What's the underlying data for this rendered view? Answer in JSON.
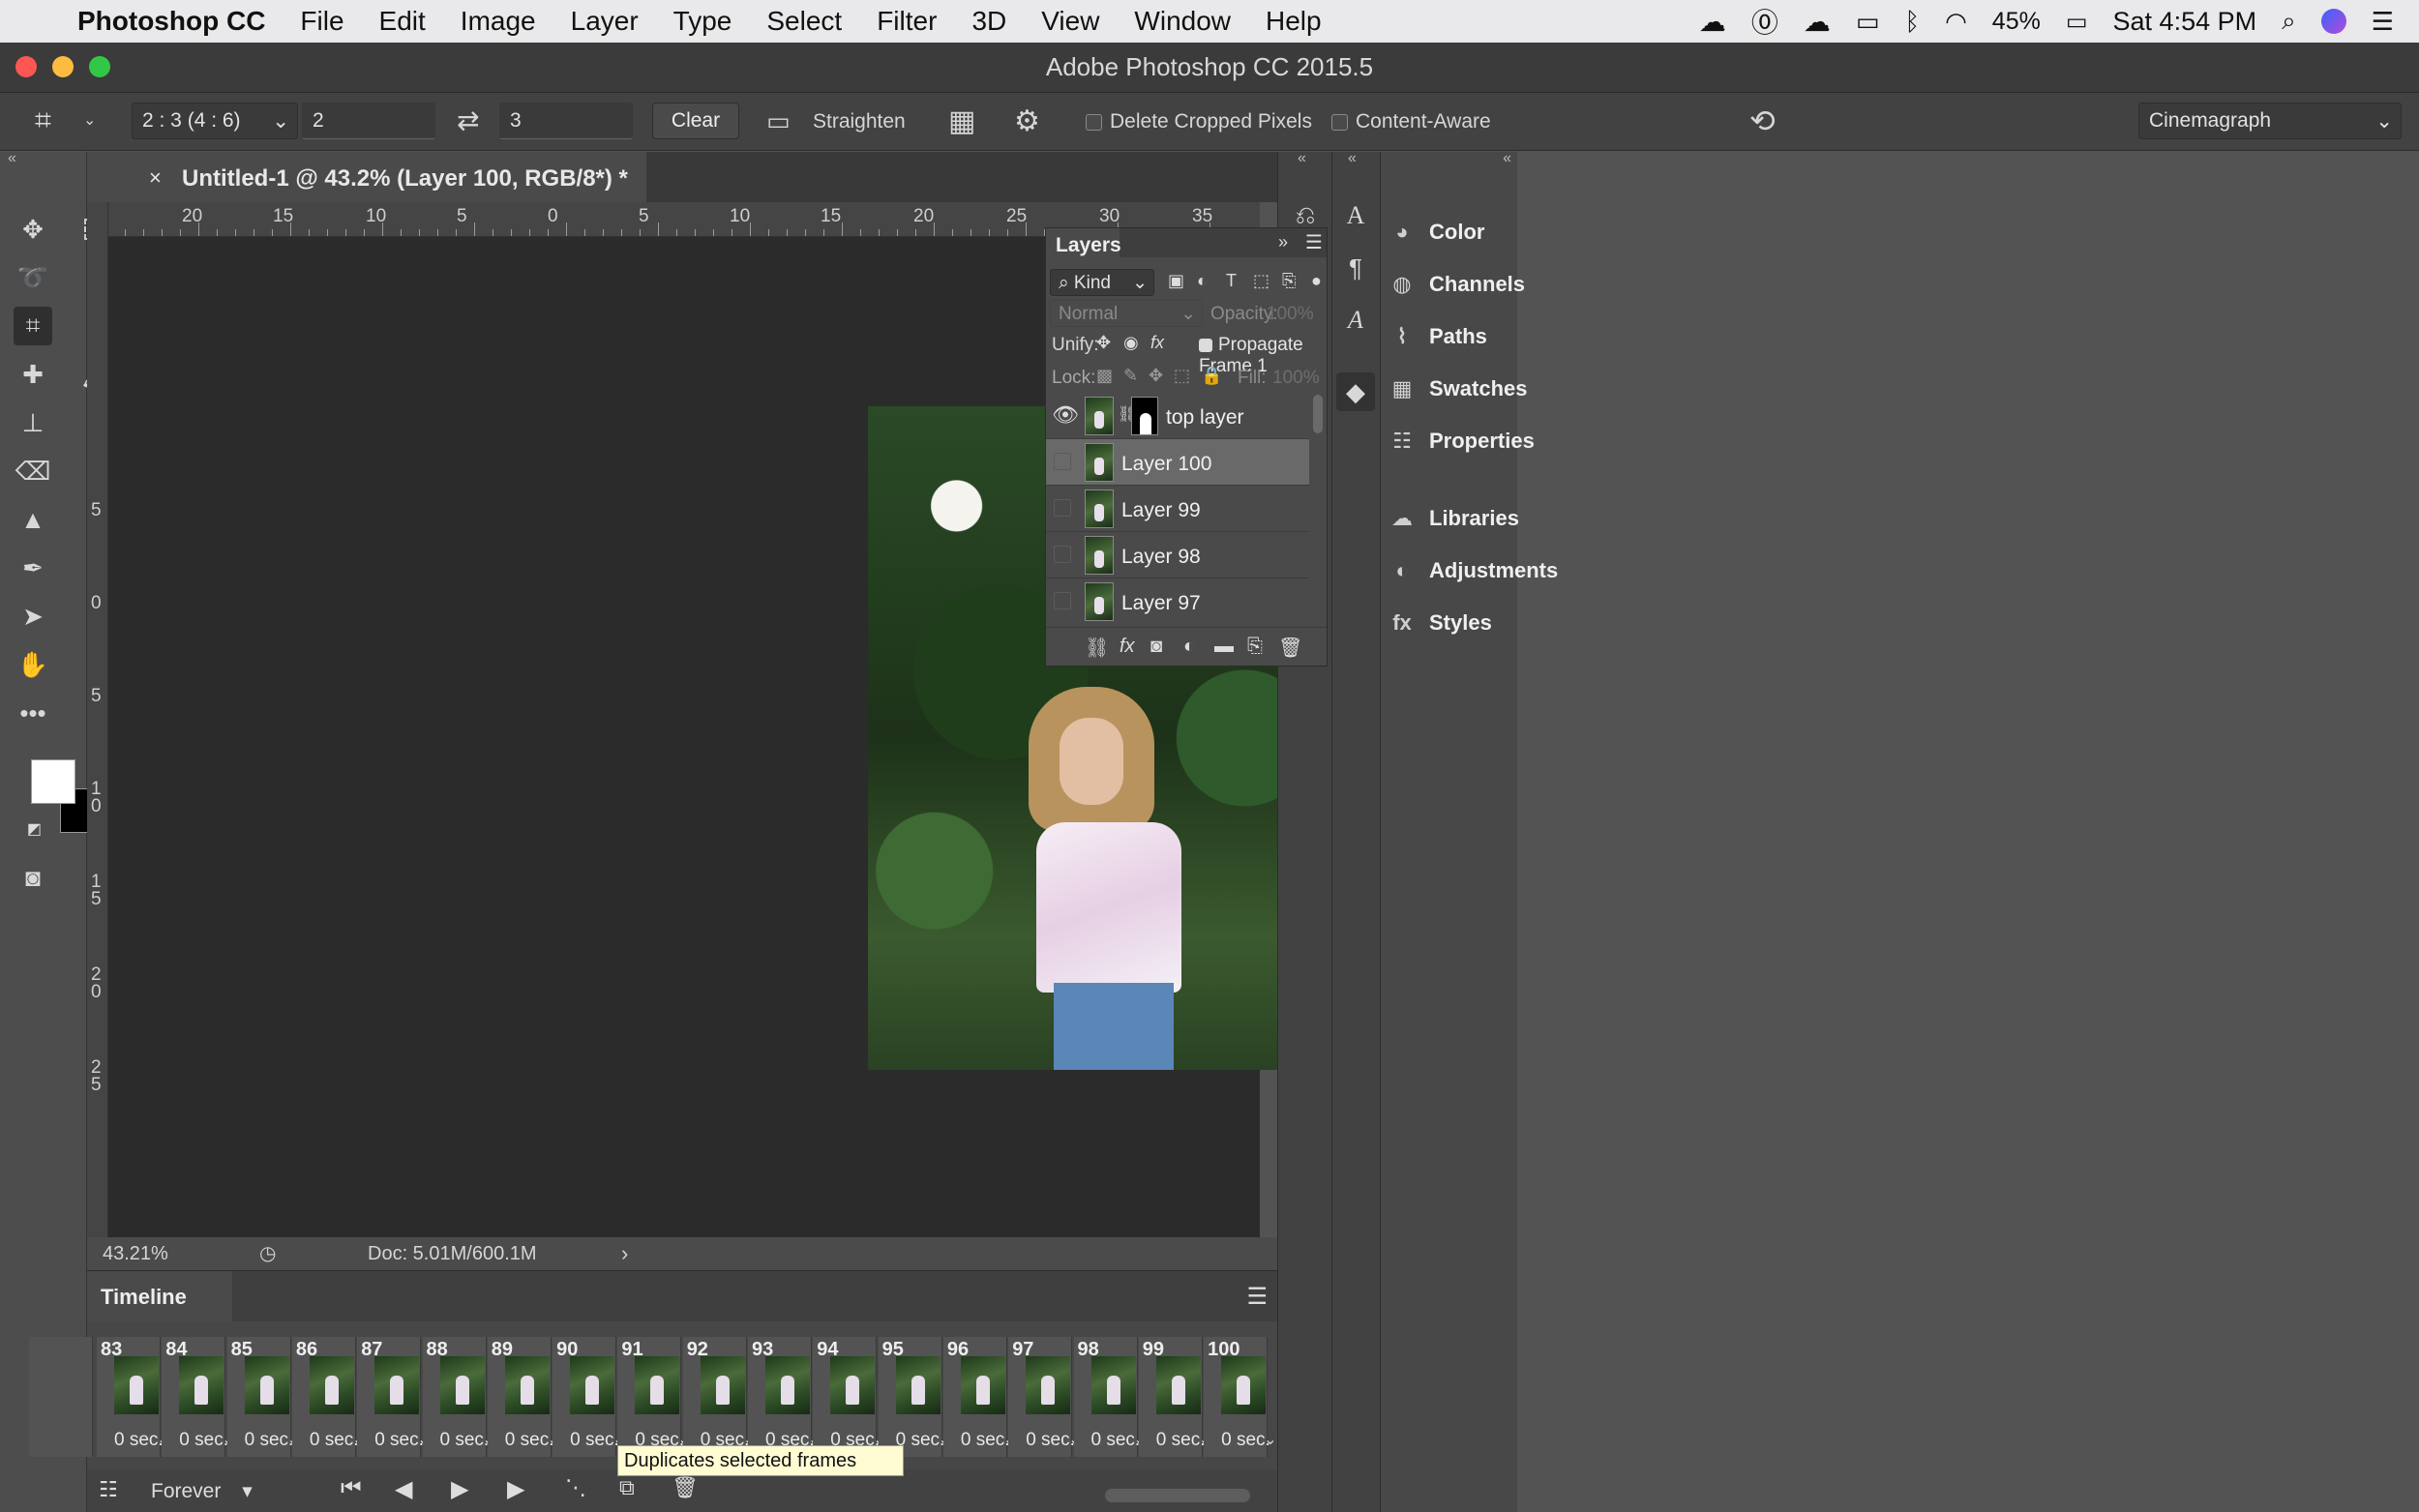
{
  "menubar": {
    "app": "Photoshop CC",
    "items": [
      "File",
      "Edit",
      "Image",
      "Layer",
      "Type",
      "Select",
      "Filter",
      "3D",
      "View",
      "Window",
      "Help"
    ],
    "battery": "45%",
    "clock": "Sat 4:54 PM"
  },
  "window": {
    "title": "Adobe Photoshop CC 2015.5"
  },
  "options": {
    "ratio": "2 : 3 (4 : 6)",
    "width": "2",
    "height": "3",
    "clear": "Clear",
    "straighten": "Straighten",
    "delete_cropped": "Delete Cropped Pixels",
    "content_aware": "Content-Aware",
    "workspace": "Cinemagraph"
  },
  "document": {
    "tab_title": "Untitled-1 @ 43.2% (Layer 100, RGB/8*) *"
  },
  "ruler": {
    "top": [
      "20",
      "15",
      "10",
      "5",
      "0",
      "5",
      "10",
      "15",
      "20",
      "25",
      "30",
      "35"
    ],
    "left": [
      "5",
      "0",
      "5",
      "1\n0",
      "1\n5",
      "2\n0",
      "2\n5"
    ]
  },
  "status": {
    "zoom": "43.21%",
    "doc": "Doc: 5.01M/600.1M"
  },
  "layers_panel": {
    "title": "Layers",
    "kind": "Kind",
    "blend": "Normal",
    "opacity_label": "Opacity:",
    "opacity": "100%",
    "unify_label": "Unify:",
    "propagate": "Propagate Frame 1",
    "lock_label": "Lock:",
    "fill_label": "Fill:",
    "fill": "100%",
    "layers": [
      {
        "name": "top layer",
        "visible": true
      },
      {
        "name": "Layer 100",
        "selected": true
      },
      {
        "name": "Layer 99"
      },
      {
        "name": "Layer 98"
      },
      {
        "name": "Layer 97"
      }
    ]
  },
  "side_panels": [
    "Color",
    "Channels",
    "Paths",
    "Swatches",
    "Properties",
    "Libraries",
    "Adjustments",
    "Styles"
  ],
  "timeline": {
    "title": "Timeline",
    "frames": [
      {
        "n": "83",
        "d": "0 sec."
      },
      {
        "n": "84",
        "d": "0 sec."
      },
      {
        "n": "85",
        "d": "0 sec."
      },
      {
        "n": "86",
        "d": "0 sec."
      },
      {
        "n": "87",
        "d": "0 sec."
      },
      {
        "n": "88",
        "d": "0 sec."
      },
      {
        "n": "89",
        "d": "0 sec."
      },
      {
        "n": "90",
        "d": "0 sec."
      },
      {
        "n": "91",
        "d": "0 sec."
      },
      {
        "n": "92",
        "d": "0 sec."
      },
      {
        "n": "93",
        "d": "0 sec."
      },
      {
        "n": "94",
        "d": "0 sec."
      },
      {
        "n": "95",
        "d": "0 sec."
      },
      {
        "n": "96",
        "d": "0 sec."
      },
      {
        "n": "97",
        "d": "0 sec."
      },
      {
        "n": "98",
        "d": "0 sec."
      },
      {
        "n": "99",
        "d": "0 sec."
      },
      {
        "n": "100",
        "d": "0 sec."
      }
    ],
    "loop": "Forever",
    "tooltip": "Duplicates selected frames"
  }
}
